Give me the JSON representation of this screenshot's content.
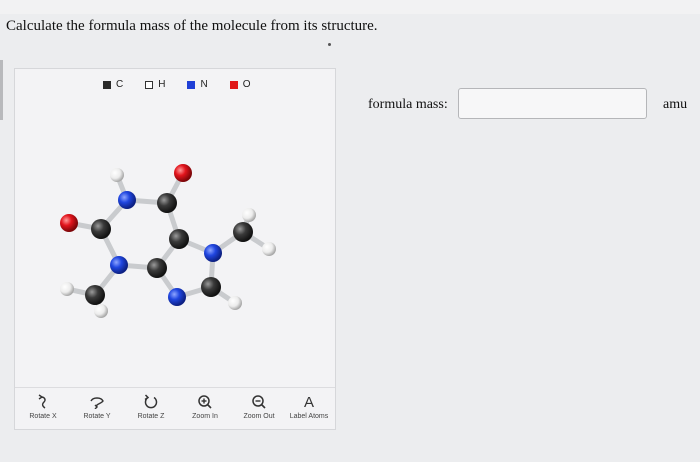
{
  "question": {
    "text": "Calculate the formula mass of the molecule from its structure."
  },
  "legend": [
    {
      "symbol": "C",
      "color": "#2a2a2a"
    },
    {
      "symbol": "H",
      "color": "#f2f2f2"
    },
    {
      "symbol": "N",
      "color": "#1f3fd6"
    },
    {
      "symbol": "O",
      "color": "#e01818"
    }
  ],
  "controls": [
    {
      "label": "Rotate X",
      "icon": "rotate-x-icon"
    },
    {
      "label": "Rotate Y",
      "icon": "rotate-y-icon"
    },
    {
      "label": "Rotate Z",
      "icon": "rotate-z-icon"
    },
    {
      "label": "Zoom In",
      "icon": "zoom-in-icon"
    },
    {
      "label": "Zoom Out",
      "icon": "zoom-out-icon"
    },
    {
      "label": "Label Atoms",
      "icon": "label-atoms-icon",
      "glyph": "A"
    }
  ],
  "answer": {
    "label": "formula mass:",
    "value": "",
    "unit": "amu"
  },
  "colors": {
    "carbon": "#3a3a3a",
    "hydrogen": "#f4f4f4",
    "nitrogen": "#2046e0",
    "oxygen": "#e2141c",
    "bond": "#c9cbce"
  }
}
